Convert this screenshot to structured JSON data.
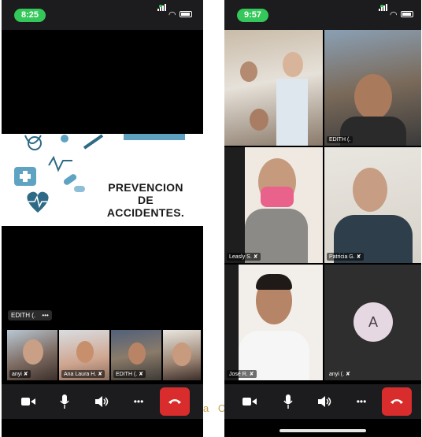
{
  "left": {
    "time": "8:25",
    "slide_title_lines": [
      "PREVENCION",
      "DE",
      "ACCIDENTES."
    ],
    "presenter_chip": "EDITH (.",
    "presenter_more": "•••",
    "thumbs": [
      {
        "name": "anyi"
      },
      {
        "name": "Ana Laura H."
      },
      {
        "name": "EDITH (."
      }
    ]
  },
  "right": {
    "time": "9:57",
    "tiles": [
      {
        "name": ""
      },
      {
        "name": "EDITH (."
      },
      {
        "name": "Leasly S."
      },
      {
        "name": "Patricia G."
      },
      {
        "name": "José R."
      },
      {
        "name": "anyi (."
      }
    ],
    "avatar_letter": "A"
  },
  "stray_text": "a C",
  "colors": {
    "status_pill": "#34c759",
    "end_call": "#d92d2d",
    "toolbar": "#1c1c1e"
  },
  "toolbar_icons": [
    "video-icon",
    "microphone-icon",
    "speaker-icon",
    "more-icon",
    "end-call-icon"
  ]
}
